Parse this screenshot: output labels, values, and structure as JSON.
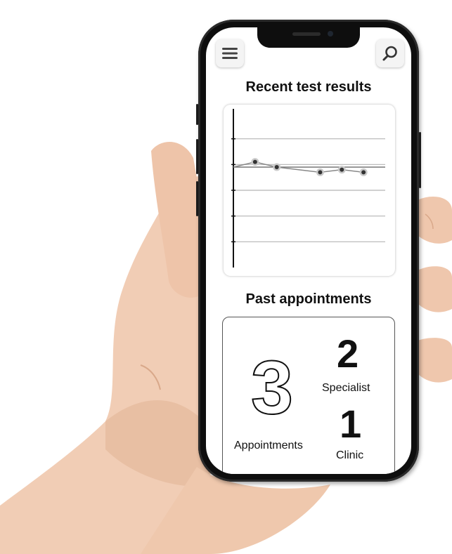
{
  "header": {
    "menu_icon": "hamburger-menu-icon",
    "search_icon": "search-icon"
  },
  "results": {
    "title": "Recent test results"
  },
  "chart_data": {
    "type": "line",
    "title": "",
    "xlabel": "",
    "ylabel": "",
    "x": [
      1,
      2,
      3,
      4,
      5,
      6
    ],
    "series": [
      {
        "values": [
          2.05,
          1.95,
          1.85,
          1.9,
          1.85
        ]
      }
    ],
    "points_x": [
      1,
      2,
      4,
      5,
      6
    ],
    "reference_line": 1.95,
    "ylim": [
      0,
      3
    ],
    "xlim": [
      0,
      7
    ],
    "grid": true,
    "colors": {
      "line": "#888888",
      "marker": "#333333",
      "grid": "#b5b5b5",
      "axis": "#111111"
    }
  },
  "appointments": {
    "title": "Past appointments",
    "total_value": "3",
    "total_label": "Appointments",
    "specialist_value": "2",
    "specialist_label": "Specialist",
    "clinic_value": "1",
    "clinic_label": "Clinic"
  }
}
